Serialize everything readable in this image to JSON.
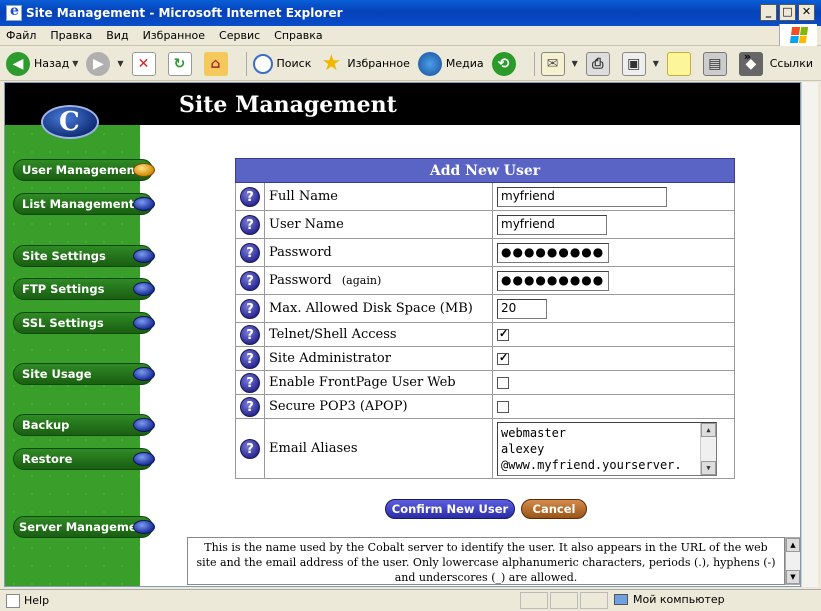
{
  "window": {
    "title": "Site Management - Microsoft Internet Explorer",
    "min_glyph": "_",
    "max_glyph": "□",
    "close_glyph": "✕"
  },
  "menu": [
    "Файл",
    "Правка",
    "Вид",
    "Избранное",
    "Сервис",
    "Справка"
  ],
  "toolbar": {
    "back_label": "Назад",
    "search_label": "Поиск",
    "favorites_label": "Избранное",
    "media_label": "Медиа",
    "links_label": "Ссылки",
    "chevron": "»"
  },
  "page": {
    "title": "Site Management"
  },
  "sidebar": {
    "items": [
      {
        "label": "User Management"
      },
      {
        "label": "List Management"
      },
      {
        "label": "Site Settings"
      },
      {
        "label": "FTP Settings"
      },
      {
        "label": "SSL Settings"
      },
      {
        "label": "Site Usage"
      },
      {
        "label": "Backup"
      },
      {
        "label": "Restore"
      },
      {
        "label": "Server Management"
      }
    ]
  },
  "form": {
    "header": "Add New User",
    "help_glyph": "?",
    "fields": {
      "full_name": {
        "label": "Full Name",
        "value": "myfriend"
      },
      "user_name": {
        "label": "User Name",
        "value": "myfriend"
      },
      "password": {
        "label": "Password",
        "value": "●●●●●●●●●"
      },
      "password_again": {
        "label": "Password",
        "suffix": "(again)",
        "value": "●●●●●●●●●"
      },
      "disk_space": {
        "label": "Max. Allowed Disk Space (MB)",
        "value": "20"
      },
      "telnet": {
        "label": "Telnet/Shell Access",
        "checked": true
      },
      "site_admin": {
        "label": "Site Administrator",
        "checked": true
      },
      "frontpage": {
        "label": "Enable FrontPage User Web",
        "checked": false
      },
      "apop": {
        "label": "Secure POP3 (APOP)",
        "checked": false
      },
      "aliases": {
        "label": "Email Aliases",
        "lines": [
          "webmaster",
          "alexey",
          "@www.myfriend.yourserver."
        ]
      }
    }
  },
  "buttons": {
    "confirm": "Confirm New User",
    "cancel": "Cancel"
  },
  "helpbox": {
    "text": "This is the name used by the Cobalt server to identify the user. It also appears in the URL of the web site and the email address of the user. Only lowercase alphanumeric characters, periods (.), hyphens (-) and underscores (_) are allowed."
  },
  "status": {
    "left": "Help",
    "zone": "Мой компьютер"
  }
}
